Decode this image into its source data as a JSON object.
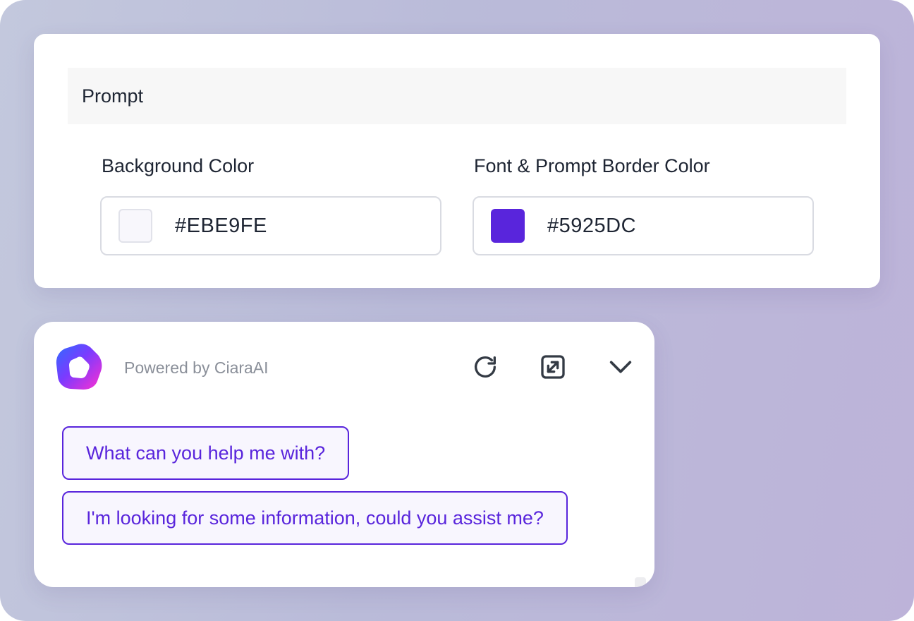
{
  "prompt_settings": {
    "section_title": "Prompt",
    "background_color": {
      "label": "Background Color",
      "value": "#EBE9FE",
      "swatch": "#F8F7FC"
    },
    "font_border_color": {
      "label": "Font & Prompt Border Color",
      "value": "#5925DC",
      "swatch": "#5925DC"
    }
  },
  "chat_widget": {
    "powered_by": "Powered by CiaraAI",
    "header_icons": [
      "ciara-logo-icon",
      "refresh-icon",
      "expand-icon",
      "chevron-down-icon"
    ],
    "suggestions": [
      "What can you help me with?",
      "I'm looking for some information, could you assist me?"
    ]
  },
  "colors": {
    "accent": "#5925DC",
    "suggestion_bg": "#F8F6FE",
    "text_primary": "#1E2533",
    "text_muted": "#8A8F99"
  }
}
